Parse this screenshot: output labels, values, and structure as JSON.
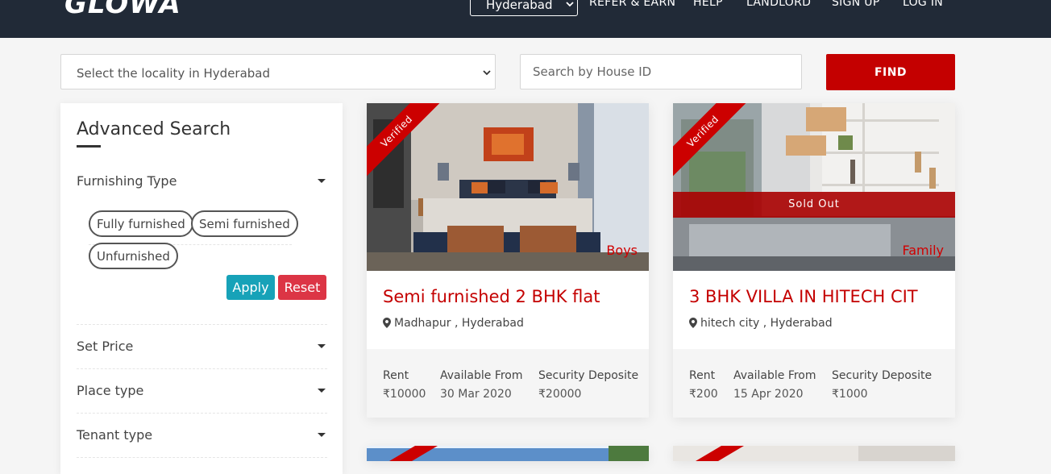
{
  "header": {
    "logo": "GLOWA",
    "city": "Hyderabad",
    "nav": [
      "REFER & EARN",
      "HELP",
      "LANDLORD",
      "SIGN UP",
      "LOG IN"
    ]
  },
  "search": {
    "locality_placeholder": "Select the locality in Hyderabad",
    "house_placeholder": "Search by House ID",
    "find_label": "FIND"
  },
  "sidebar": {
    "title": "Advanced Search",
    "furnishing": {
      "label": "Furnishing Type",
      "options": [
        "Fully furnished",
        "Semi furnished",
        "Unfurnished"
      ],
      "apply": "Apply",
      "reset": "Reset"
    },
    "sections": [
      "Set Price",
      "Place type",
      "Tenant type"
    ]
  },
  "listings": [
    {
      "badge": "Verified",
      "tenant": "Boys",
      "title": "Semi furnished 2 BHK flat",
      "location": "Madhapur , Hyderabad",
      "rent_label": "Rent",
      "rent": "₹10000",
      "available_label": "Available From",
      "available": "30 Mar 2020",
      "deposit_label": "Security Deposite",
      "deposit": "₹20000",
      "sold_out": ""
    },
    {
      "badge": "Verified",
      "tenant": "Family",
      "title": "3 BHK VILLA IN HITECH CIT",
      "location": "hitech city , Hyderabad",
      "rent_label": "Rent",
      "rent": "₹200",
      "available_label": "Available From",
      "available": "15 Apr 2020",
      "deposit_label": "Security Deposite",
      "deposit": "₹1000",
      "sold_out": "Sold Out"
    }
  ],
  "colors": {
    "header_bg": "#212a37",
    "accent_red": "#c40000",
    "apply": "#17a2b8",
    "reset": "#dc3545"
  }
}
